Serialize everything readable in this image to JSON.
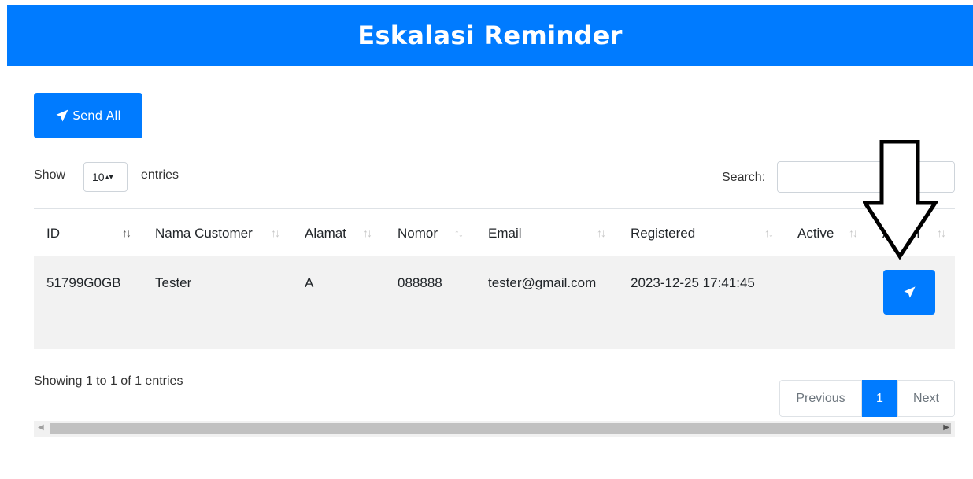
{
  "header": {
    "title": "Eskalasi Reminder"
  },
  "toolbar": {
    "send_all_label": "Send All",
    "send_icon": "paper-plane-icon"
  },
  "controls": {
    "show_label": "Show",
    "entries_value": "10",
    "entries_label": "entries",
    "search_label": "Search:",
    "search_value": ""
  },
  "table": {
    "columns": [
      "ID",
      "Nama Customer",
      "Alamat",
      "Nomor",
      "Email",
      "Registered",
      "Active",
      "Action"
    ],
    "rows": [
      {
        "id": "51799G0GB",
        "nama_customer": "Tester",
        "alamat": "A",
        "nomor": "088888",
        "email": "tester@gmail.com",
        "registered": "2023-12-25 17:41:45",
        "active": ""
      }
    ]
  },
  "footer": {
    "info": "Showing 1 to 1 of 1 entries",
    "pagination": {
      "previous": "Previous",
      "current": "1",
      "next": "Next"
    }
  },
  "colors": {
    "primary": "#007bff",
    "row_bg": "#f2f2f2"
  }
}
